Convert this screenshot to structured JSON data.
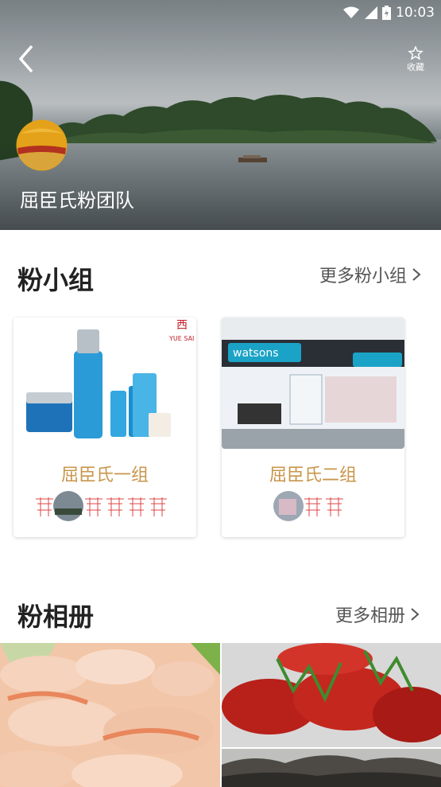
{
  "status_bar": {
    "time": "10:03"
  },
  "header": {
    "team_name": "屈臣氏粉团队",
    "favorite_label": "收藏"
  },
  "groups_section": {
    "title": "粉小组",
    "more_label": "更多粉小组",
    "cards": [
      {
        "name": "屈臣氏一组",
        "brand_mark": "YUE SAI"
      },
      {
        "name": "屈臣氏二组",
        "store_sign": "watsons"
      }
    ]
  },
  "albums_section": {
    "title": "粉相册",
    "more_label": "更多相册"
  },
  "colors": {
    "accent_gold": "#c8964a",
    "title_dark": "#222222"
  }
}
